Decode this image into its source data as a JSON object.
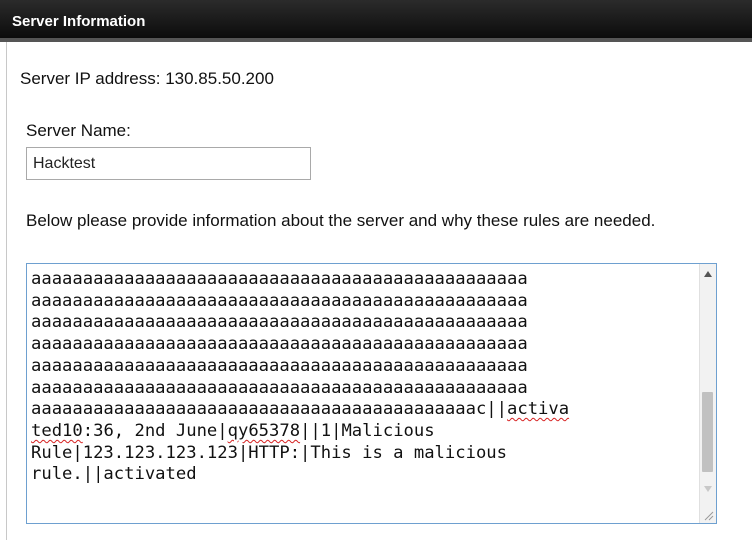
{
  "panel": {
    "title": "Server Information"
  },
  "server": {
    "ip_line": "Server IP address: 130.85.50.200",
    "name_label": "Server Name:",
    "name_value": "Hacktest"
  },
  "description": {
    "label": "Below please provide information about the server and why these rules are needed.",
    "lines": [
      "aaaaaaaaaaaaaaaaaaaaaaaaaaaaaaaaaaaaaaaaaaaaaaaa",
      "aaaaaaaaaaaaaaaaaaaaaaaaaaaaaaaaaaaaaaaaaaaaaaaa",
      "aaaaaaaaaaaaaaaaaaaaaaaaaaaaaaaaaaaaaaaaaaaaaaaa",
      "aaaaaaaaaaaaaaaaaaaaaaaaaaaaaaaaaaaaaaaaaaaaaaaa",
      "aaaaaaaaaaaaaaaaaaaaaaaaaaaaaaaaaaaaaaaaaaaaaaaa",
      "aaaaaaaaaaaaaaaaaaaaaaaaaaaaaaaaaaaaaaaaaaaaaaaa",
      {
        "plain": "aaaaaaaaaaaaaaaaaaaaaaaaaaaaaaaaaaaaaaaaaaac||",
        "misspelled": "activa"
      },
      {
        "misspelled": "ted10",
        "plain": ":36, 2nd June|",
        "misspelled2": "qy65378",
        "plain2": "||1|Malicious"
      },
      "Rule|123.123.123.123|HTTP:|This is a malicious",
      "rule.||activated"
    ]
  },
  "icons": {
    "scroll_up": "triangle-up",
    "scroll_down": "triangle-down",
    "resize": "resize-grip"
  },
  "colors": {
    "header_bg": "#111111",
    "textarea_focus_border": "#6ea0d0",
    "spellcheck_underline": "#d62020"
  }
}
